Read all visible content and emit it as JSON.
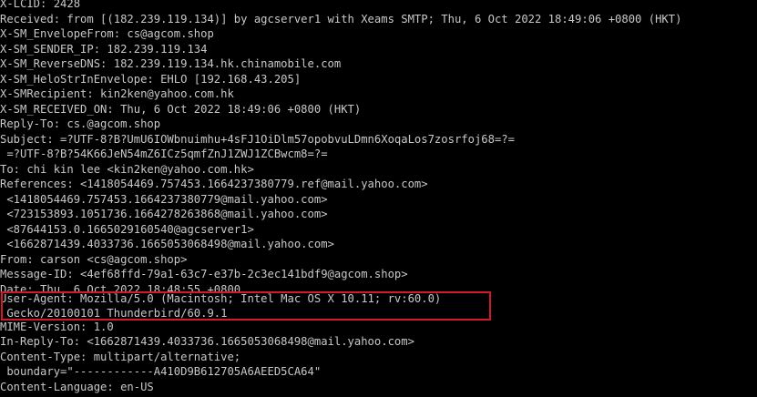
{
  "headers": [
    "X-LCID: 2428",
    "Received: from [(182.239.119.134)] by agcserver1 with Xeams SMTP; Thu, 6 Oct 2022 18:49:06 +0800 (HKT)",
    "X-SM_EnvelopeFrom: cs@agcom.shop",
    "X-SM_SENDER_IP: 182.239.119.134",
    "X-SM_ReverseDNS: 182.239.119.134.hk.chinamobile.com",
    "X-SM_HeloStrInEnvelope: EHLO [192.168.43.205]",
    "X-SMRecipient: kin2ken@yahoo.com.hk",
    "X-SM_RECEIVED_ON: Thu, 6 Oct 2022 18:49:06 +0800 (HKT)",
    "Reply-To: cs.@agcom.shop",
    "Subject: =?UTF-8?B?UmU6IOWbnuimhu+4sFJ1OiDlm57opobvuLDmn6XoqaLos7zosrfoj68=?=",
    " =?UTF-8?B?54K66JeN54mZ6ICz5qmfZnJ1ZWJ1ZCBwcm8=?=",
    "To: chi kin lee <kin2ken@yahoo.com.hk>",
    "References: <1418054469.757453.1664237380779.ref@mail.yahoo.com>",
    " <1418054469.757453.1664237380779@mail.yahoo.com>",
    " <723153893.1051736.1664278263868@mail.yahoo.com>",
    " <87644153.0.1665029160540@agcserver1>",
    " <1662871439.4033736.1665053068498@mail.yahoo.com>",
    "From: carson <cs@agcom.shop>",
    "Message-ID: <4ef68ffd-79a1-63c7-e37b-2c3ec141bdf9@agcom.shop>",
    "Date: Thu, 6 Oct 2022 18:48:55 +0800",
    "User-Agent: Mozilla/5.0 (Macintosh; Intel Mac OS X 10.11; rv:60.0)",
    " Gecko/20100101 Thunderbird/60.9.1",
    "MIME-Version: 1.0",
    "In-Reply-To: <1662871439.4033736.1665053068498@mail.yahoo.com>",
    "Content-Type: multipart/alternative;",
    " boundary=\"------------A410D9B612705A6AEED5CA64\"",
    "Content-Language: en-US"
  ],
  "colors": {
    "background": "#000000",
    "text": "#c8c8c8",
    "highlight": "#d11a2a"
  }
}
